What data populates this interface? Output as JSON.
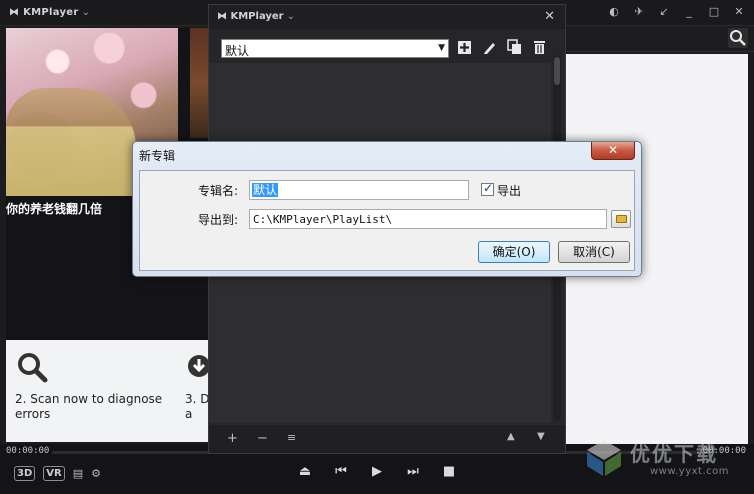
{
  "app": {
    "logo_text": "KMPlayer",
    "chevron": "⌄"
  },
  "main_title_icons": [
    "toggle-icon",
    "pin-icon",
    "minimize-to-corner-icon",
    "minimize-icon",
    "restore-icon",
    "close-icon"
  ],
  "left_panel": {
    "caption": "你的养老钱翻几倍",
    "step2_text": "2. Scan now to diagnose errors",
    "step3_text": "3. D\na"
  },
  "playlist": {
    "title": "KMPlayer",
    "album_selected": "默认",
    "tools": [
      "add-icon",
      "edit-icon",
      "copy-icon",
      "delete-icon"
    ],
    "bottom_controls": [
      "+",
      "−",
      "≡",
      "▲",
      "▼"
    ]
  },
  "dialog": {
    "title": "新专辑",
    "close_label": "✕",
    "name_label": "专辑名:",
    "name_value": "默认",
    "export_checked": true,
    "export_label": "导出",
    "export_to_label": "导出到:",
    "export_path": "C:\\KMPlayer\\PlayList\\",
    "ok_label": "确定(O)",
    "cancel_label": "取消(C)"
  },
  "player": {
    "time_left": "00:00:00",
    "time_right": "00:00:00",
    "badge_3d": "3D",
    "badge_vr": "VR",
    "transport": [
      "⏏",
      "⏮",
      "▶",
      "⏭",
      "■"
    ]
  },
  "watermark": {
    "text": "优优下载",
    "url": "www.yyxt.com"
  },
  "colors": {
    "accent_selection": "#3399ff",
    "dialog_close": "#c85a42"
  }
}
